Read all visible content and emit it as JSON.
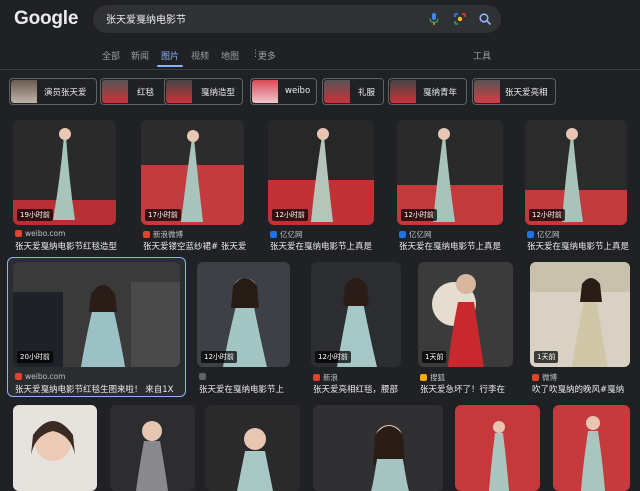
{
  "logo": "Google",
  "search": {
    "query": "张天爱戛纳电影节"
  },
  "icons": [
    "mic-icon",
    "lens-icon",
    "search-icon",
    "more-vert-icon"
  ],
  "tabs": [
    {
      "label": "全部"
    },
    {
      "label": "新闻"
    },
    {
      "label": "图片",
      "active": true
    },
    {
      "label": "视频"
    },
    {
      "label": "地图"
    },
    {
      "label": "更多"
    }
  ],
  "tools_label": "工具",
  "chips": [
    "演员张天爱",
    "红毯",
    "戛纳造型",
    "weibo",
    "礼服",
    "戛纳青年",
    "张天爱亮相"
  ],
  "results_row1": [
    {
      "time": "19小时前",
      "source": "weibo.com",
      "title": "张天爱戛纳电影节红毯造型",
      "fav": "#e0452c"
    },
    {
      "time": "17小时前",
      "source": "新浪微博",
      "title": "张天爱镂空蓝纱裙# 张天爱",
      "fav": "#e0452c"
    },
    {
      "time": "12小时前",
      "source": "亿亿网",
      "title": "张天爱在戛纳电影节上真是",
      "fav": "#1a73e8"
    },
    {
      "time": "12小时前",
      "source": "亿亿网",
      "title": "张天爱在戛纳电影节上真是",
      "fav": "#1a73e8"
    },
    {
      "time": "12小时前",
      "source": "亿亿网",
      "title": "张天爱在戛纳电影节上真是",
      "fav": "#1a73e8"
    }
  ],
  "results_row2": [
    {
      "time": "20小时前",
      "source": "weibo.com",
      "title": "张天爱戛纳电影节红毯生图来啦！ 来自1X",
      "fav": "#e0452c"
    },
    {
      "time": "12小时前",
      "source": "",
      "title": "张天爱在戛纳电影节上",
      "fav": "#5f6368"
    },
    {
      "time": "12小时前",
      "source": "新浪",
      "title": "张天爱亮相红毯，腰部",
      "fav": "#e0452c"
    },
    {
      "time": "1天前",
      "source": "搜狐",
      "title": "张天爱急坏了！行李在",
      "fav": "#f9ab00"
    },
    {
      "time": "1天前",
      "source": "微博",
      "title": "吹了吹戛纳的晚风#戛纳",
      "fav": "#e0452c"
    }
  ]
}
